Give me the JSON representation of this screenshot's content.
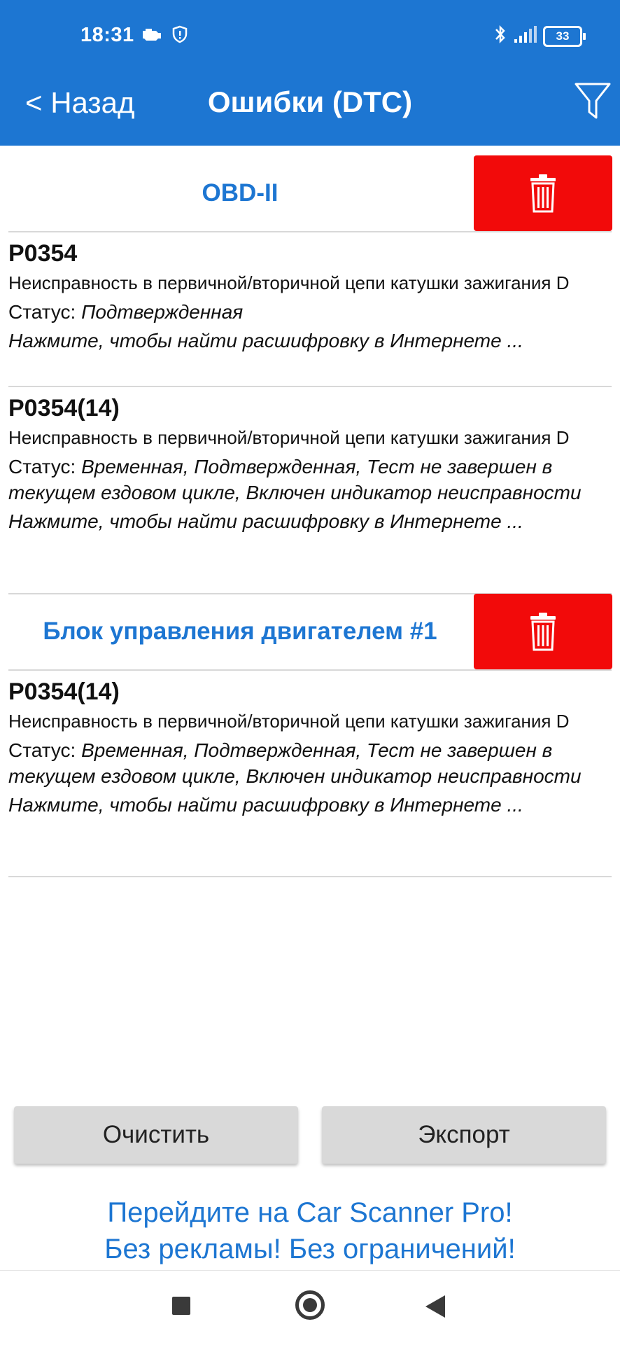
{
  "status_bar": {
    "time": "18:31",
    "battery": "33"
  },
  "app_bar": {
    "back_label": "< Назад",
    "title": "Ошибки (DTC)"
  },
  "sections": [
    {
      "title": "OBD-II",
      "codes": [
        {
          "code": "P0354",
          "description": "Неисправность в первичной/вторичной цепи катушки зажигания D",
          "status_label": "Статус: ",
          "status_value": "Подтвержденная",
          "link": "Нажмите, чтобы найти расшифровку в Интернете ..."
        },
        {
          "code": "P0354(14)",
          "description": "Неисправность в первичной/вторичной цепи катушки зажигания D",
          "status_label": "Статус: ",
          "status_value": "Временная, Подтвержденная, Тест не завершен в текущем ездовом цикле, Включен индикатор неисправности",
          "link": "Нажмите, чтобы найти расшифровку в Интернете ..."
        }
      ]
    },
    {
      "title": "Блок управления двигателем #1",
      "codes": [
        {
          "code": "P0354(14)",
          "description": "Неисправность в первичной/вторичной цепи катушки зажигания D",
          "status_label": "Статус: ",
          "status_value": "Временная, Подтвержденная, Тест не завершен в текущем ездовом цикле, Включен индикатор неисправности",
          "link": "Нажмите, чтобы найти расшифровку в Интернете ..."
        }
      ]
    }
  ],
  "actions": {
    "clear_label": "Очистить",
    "export_label": "Экспорт"
  },
  "promo": {
    "line1": "Перейдите на Car Scanner Pro!",
    "line2": "Без рекламы! Без ограничений!"
  },
  "colors": {
    "primary": "#1d76d2",
    "delete": "#f20a0a",
    "button": "#d9d9d9"
  },
  "icons": [
    "engine-icon",
    "shield-icon",
    "bluetooth-icon",
    "signal-icon",
    "battery-icon",
    "filter-icon",
    "trash-icon",
    "recent-apps-icon",
    "home-icon",
    "back-icon"
  ]
}
